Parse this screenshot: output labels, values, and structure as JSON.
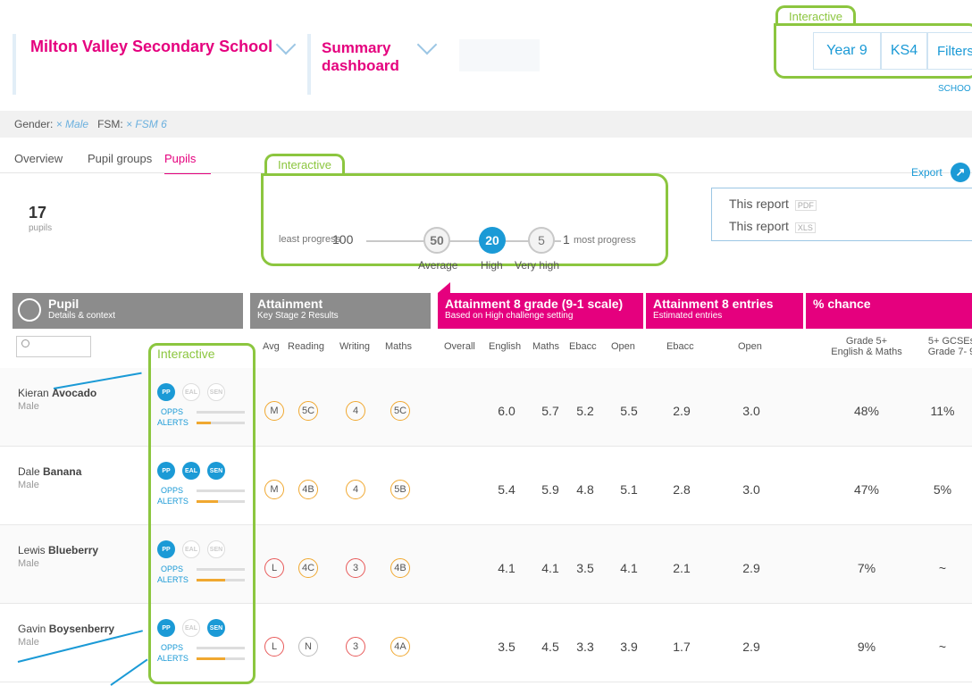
{
  "header": {
    "school": "Milton Valley Secondary School",
    "dashboard_line1": "Summary",
    "dashboard_line2": "dashboard",
    "year": "Year 9",
    "stage": "KS4",
    "filters": "Filters",
    "school_label": "SCHOO"
  },
  "filterbar": {
    "gender_label": "Gender:",
    "gender_value": "× Male",
    "fsm_label": "FSM:",
    "fsm_value": "× FSM 6"
  },
  "tabs": [
    "Overview",
    "Pupil groups",
    "Pupils"
  ],
  "interactive_label": "Interactive",
  "pupil_count": "17",
  "pupil_count_label": "pupils",
  "progress": {
    "least": "least progress",
    "least_value": "100",
    "avg_value": "50",
    "high_value": "20",
    "vhigh_value": "5",
    "most_value": "1",
    "most": "most progress",
    "avg_label": "Average",
    "high_label": "High",
    "vhigh_label": "Very high"
  },
  "export": {
    "label": "Export",
    "report1": "This report",
    "report1_fmt": "PDF",
    "report2": "This report",
    "report2_fmt": "XLS"
  },
  "groups": {
    "pupil_title": "Pupil",
    "pupil_sub": "Details & context",
    "att_title": "Attainment",
    "att_sub": "Key Stage 2 Results",
    "a8_title": "Attainment 8 grade (9-1 scale)",
    "a8_sub": "Based on High challenge setting",
    "a8e_title": "Attainment 8 entries",
    "a8e_sub": "Estimated entries",
    "chance_title": "% chance"
  },
  "columns": {
    "avg": "Avg",
    "reading": "Reading",
    "writing": "Writing",
    "maths": "Maths",
    "overall": "Overall",
    "english": "English",
    "maths2": "Maths",
    "ebacc": "Ebacc",
    "open": "Open",
    "ebacc2": "Ebacc",
    "open2": "Open",
    "grade5_1": "Grade 5+",
    "grade5_2": "English & Maths",
    "gcse_1": "5+ GCSEs",
    "gcse_2": "Grade 7- 9"
  },
  "labels": {
    "opps": "OPPS",
    "alerts": "ALERTS",
    "pp": "PP",
    "eal": "EAL",
    "sen": "SEN"
  },
  "pupils": [
    {
      "first": "Kieran",
      "last": "Avocado",
      "gender": "Male",
      "pp": true,
      "eal": false,
      "sen": false,
      "alerts": 0.3,
      "avg": "M",
      "reading": "5C",
      "writing": "4",
      "maths": "5C",
      "gcols": [
        "amber",
        "amber",
        "amber",
        "amber"
      ],
      "english": "6.0",
      "maths_g": "5.7",
      "ebacc": "5.2",
      "open": "5.5",
      "e_ebacc": "2.9",
      "e_open": "3.0",
      "chance1": "48%",
      "chance2": "11%"
    },
    {
      "first": "Dale",
      "last": "Banana",
      "gender": "Male",
      "pp": true,
      "eal": true,
      "sen": true,
      "alerts": 0.45,
      "avg": "M",
      "reading": "4B",
      "writing": "4",
      "maths": "5B",
      "gcols": [
        "amber",
        "amber",
        "amber",
        "amber"
      ],
      "english": "5.4",
      "maths_g": "5.9",
      "ebacc": "4.8",
      "open": "5.1",
      "e_ebacc": "2.8",
      "e_open": "3.0",
      "chance1": "47%",
      "chance2": "5%"
    },
    {
      "first": "Lewis",
      "last": "Blueberry",
      "gender": "Male",
      "pp": true,
      "eal": false,
      "sen": false,
      "alerts": 0.6,
      "avg": "L",
      "reading": "4C",
      "writing": "3",
      "maths": "4B",
      "gcols": [
        "red",
        "amber",
        "red",
        "amber"
      ],
      "english": "4.1",
      "maths_g": "4.1",
      "ebacc": "3.5",
      "open": "4.1",
      "e_ebacc": "2.1",
      "e_open": "2.9",
      "chance1": "7%",
      "chance2": "~"
    },
    {
      "first": "Gavin",
      "last": "Boysenberry",
      "gender": "Male",
      "pp": true,
      "eal": false,
      "sen": true,
      "alerts": 0.6,
      "avg": "L",
      "reading": "N",
      "writing": "3",
      "maths": "4A",
      "gcols": [
        "red",
        "grey",
        "red",
        "amber"
      ],
      "english": "3.5",
      "maths_g": "4.5",
      "ebacc": "3.3",
      "open": "3.9",
      "e_ebacc": "1.7",
      "e_open": "2.9",
      "chance1": "9%",
      "chance2": "~"
    }
  ]
}
